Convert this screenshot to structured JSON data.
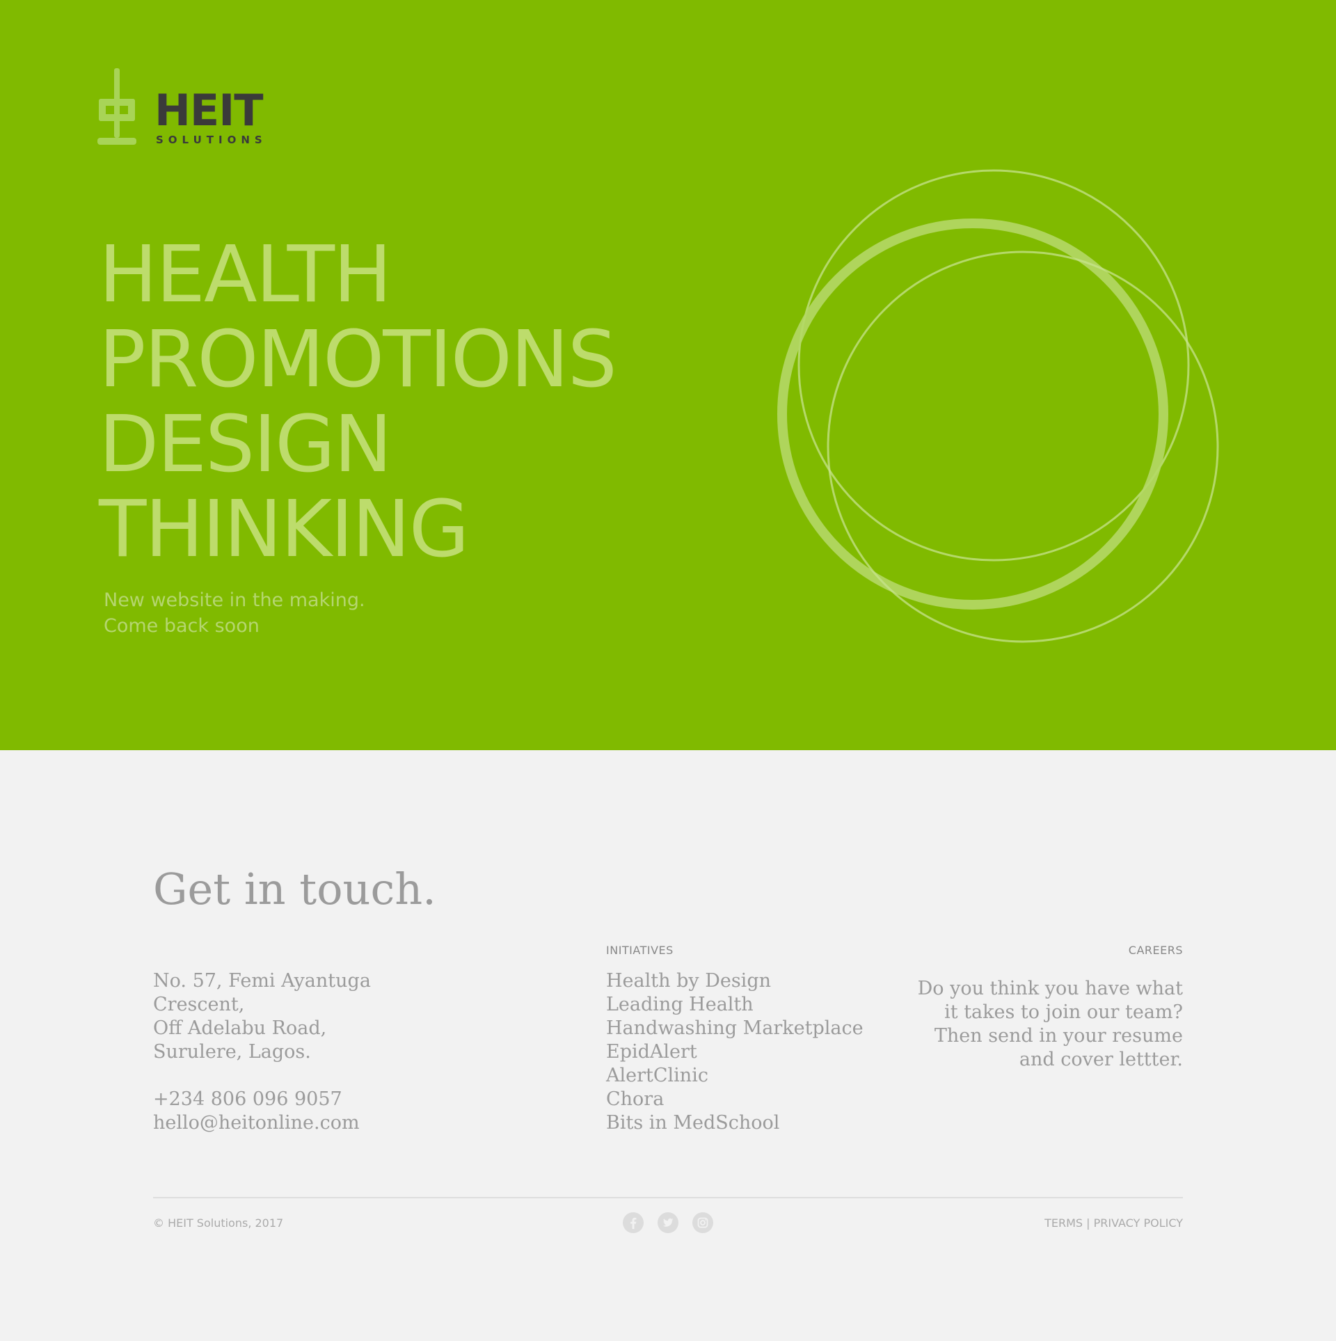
{
  "brand": {
    "name": "HEIT",
    "sub": "SOLUTIONS"
  },
  "hero": {
    "headline": [
      "HEALTH",
      "PROMOTIONS",
      "DESIGN",
      "THINKING"
    ],
    "tagline": [
      "New website in the making.",
      "Come back soon"
    ]
  },
  "contact": {
    "title": "Get in touch.",
    "address": [
      "No. 57, Femi Ayantuga",
      "Crescent,",
      "Off Adelabu Road,",
      "Surulere, Lagos."
    ],
    "phone": "+234 806 096 9057",
    "email": "hello@heitonline.com"
  },
  "initiatives": {
    "heading": "INITIATIVES",
    "items": [
      "Health by Design",
      "Leading Health",
      "Handwashing Marketplace",
      "EpidAlert",
      "AlertClinic",
      "Chora",
      "Bits in MedSchool"
    ]
  },
  "careers": {
    "heading": "CAREERS",
    "text": [
      "Do you think you have what",
      "it takes to join our team?",
      "Then send in your resume",
      "and cover lettter."
    ]
  },
  "footer": {
    "copyright": "© HEIT Solutions, 2017",
    "social_icons": [
      "facebook-icon",
      "twitter-icon",
      "instagram-icon"
    ],
    "terms": "TERMS",
    "separator": " | ",
    "privacy": "PRIVACY POLICY"
  },
  "colors": {
    "hero_bg": "#80ba00",
    "page_bg": "#f2f2f2",
    "headline": "#bddc6c",
    "logo_text": "#3a3a3a",
    "text_grey": "#9b9b9b"
  }
}
